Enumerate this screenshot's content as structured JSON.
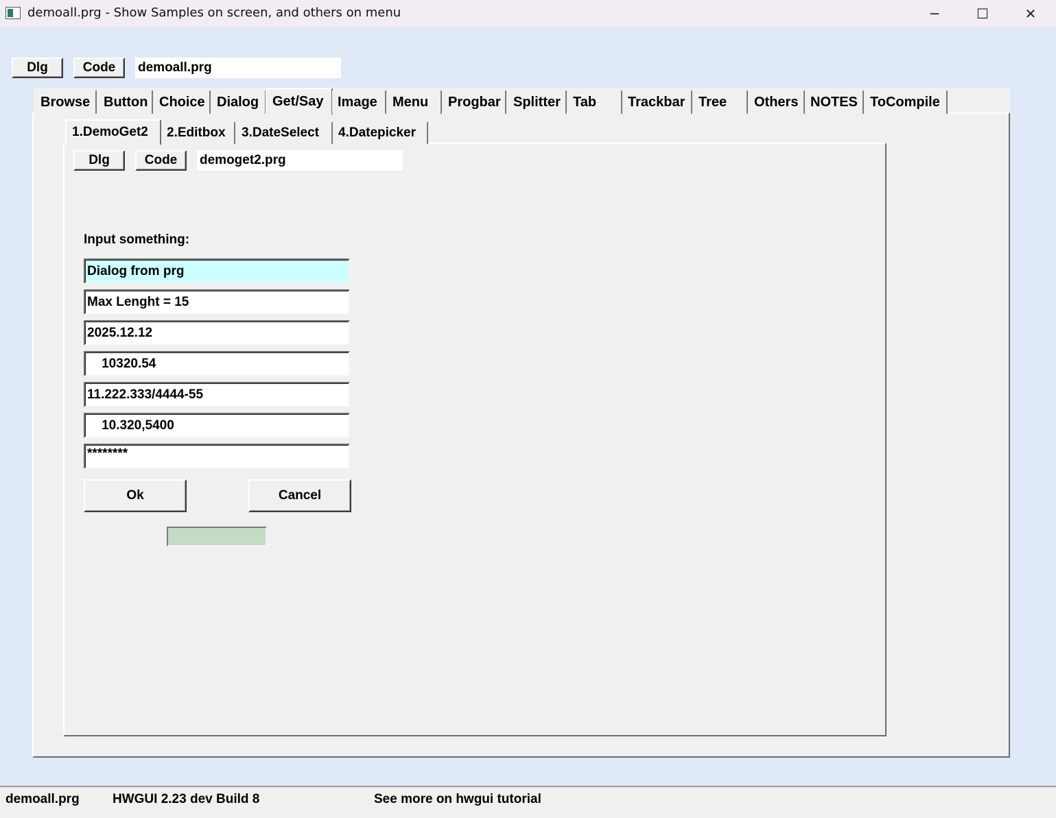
{
  "window": {
    "title": "demoall.prg - Show Samples on screen, and others on menu",
    "controls": {
      "minimize": "─",
      "maximize": "☐",
      "close": "✕"
    }
  },
  "top": {
    "dlg_label": "Dlg",
    "code_label": "Code",
    "file": "demoall.prg"
  },
  "main_tabs": [
    "Browse",
    "Button",
    "Choice",
    "Dialog",
    "Get/Say",
    "Image",
    "Menu",
    "Progbar",
    "Splitter",
    "Tab",
    "Trackbar",
    "Tree",
    "Others",
    "NOTES",
    "ToCompile"
  ],
  "main_active_tab": "Get/Say",
  "sub_tabs": [
    "1.DemoGet2",
    "2.Editbox",
    "3.DateSelect",
    "4.Datepicker"
  ],
  "sub_active_tab": "1.DemoGet2",
  "sub": {
    "dlg_label": "Dlg",
    "code_label": "Code",
    "file": "demoget2.prg"
  },
  "form": {
    "label": "Input something:",
    "fields": [
      "Dialog from prg",
      "Max Lenght = 15",
      "2025.12.12",
      "    10320.54",
      "11.222.333/4444-55",
      "    10.320,5400",
      "********"
    ],
    "ok_label": "Ok",
    "cancel_label": "Cancel",
    "progress_color": "#c4dcc4"
  },
  "status": {
    "file": "demoall.prg",
    "version": "HWGUI 2.23 dev Build 8",
    "hint": "See more on hwgui tutorial"
  },
  "colors": {
    "window_bg": "#dfe9f7",
    "panel_bg": "#f0f0f0",
    "focused_field": "#ccffff"
  }
}
